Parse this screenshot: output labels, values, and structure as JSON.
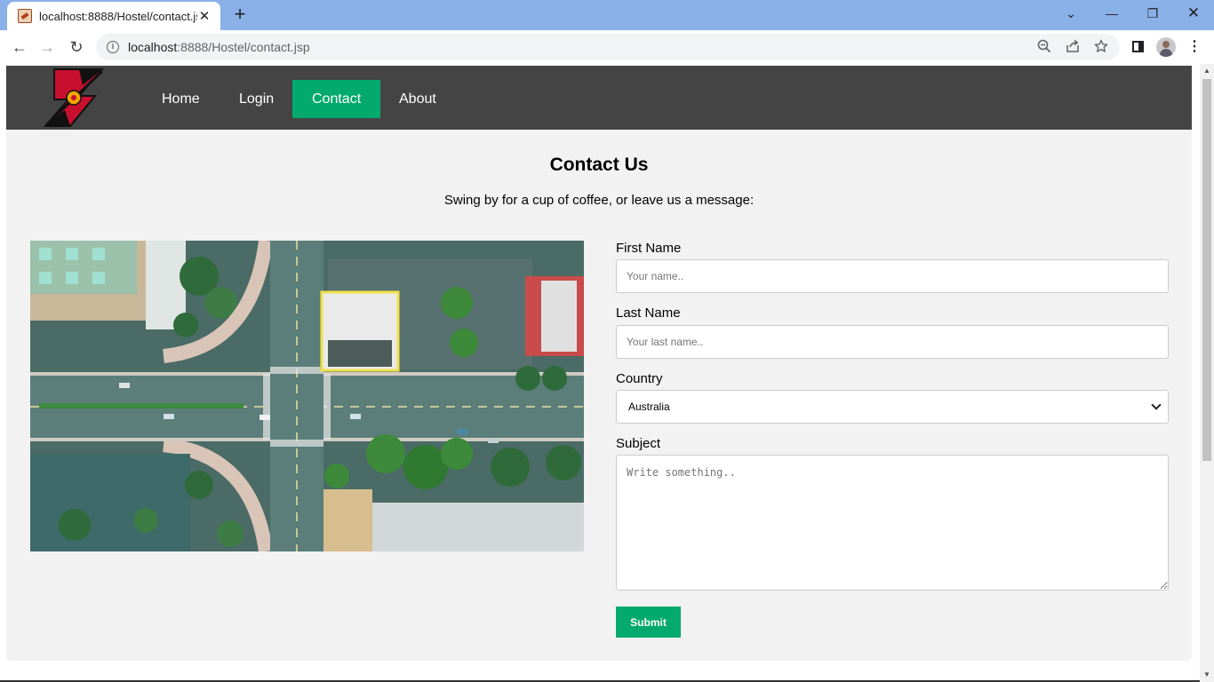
{
  "browser": {
    "tab_title": "localhost:8888/Hostel/contact.jsp",
    "url_host": "localhost",
    "url_rest": ":8888/Hostel/contact.jsp"
  },
  "nav": {
    "items": [
      {
        "label": "Home",
        "active": false
      },
      {
        "label": "Login",
        "active": false
      },
      {
        "label": "Contact",
        "active": true
      },
      {
        "label": "About",
        "active": false
      }
    ]
  },
  "page": {
    "title": "Contact Us",
    "subtitle": "Swing by for a cup of coffee, or leave us a message:"
  },
  "form": {
    "first_name_label": "First Name",
    "first_name_placeholder": "Your name..",
    "last_name_label": "Last Name",
    "last_name_placeholder": "Your last name..",
    "country_label": "Country",
    "country_selected": "Australia",
    "subject_label": "Subject",
    "subject_placeholder": "Write something..",
    "submit_label": "Submit"
  },
  "colors": {
    "accent": "#04aa6d",
    "navbar": "#444444",
    "content_bg": "#f2f2f2",
    "tabstrip": "#8ab0e8"
  },
  "icons": {
    "back": "back-arrow-icon",
    "forward": "forward-arrow-icon",
    "reload": "reload-icon",
    "site_info": "info-icon",
    "zoom": "zoom-icon",
    "share": "share-icon",
    "bookmark": "star-icon",
    "side_panel": "side-panel-icon",
    "menu": "kebab-menu-icon"
  }
}
